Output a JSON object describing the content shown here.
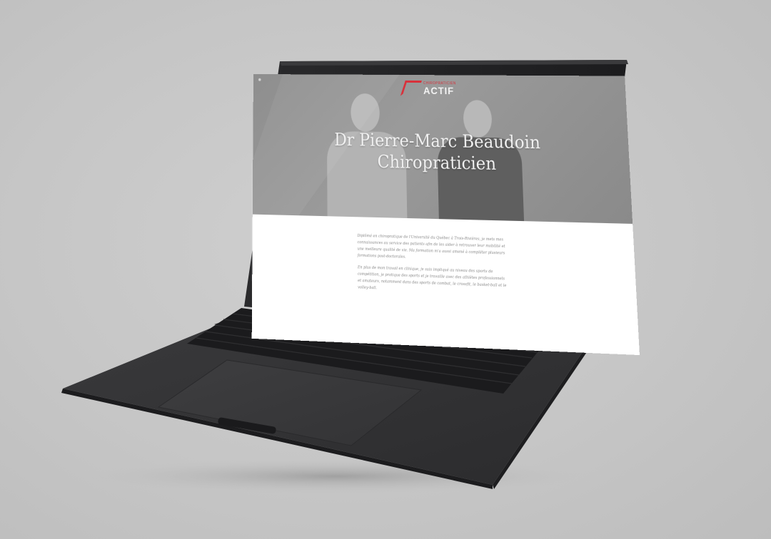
{
  "brand": {
    "small": "CHIROPRATICIEN",
    "name": "ACTIF",
    "accent_color": "#d9303a"
  },
  "hero": {
    "title_line1": "Dr Pierre-Marc Beaudoin",
    "title_line2": "Chiropraticien"
  },
  "content": {
    "paragraph1": "Diplômé en chiropratique de l'Université du Québec à Trois-Rivières, je mets mes connaissances au service des patients afin de les aider à retrouver leur mobilité et une meilleure qualité de vie. Ma formation m'a aussi amené à compléter plusieurs formations post-doctorales.",
    "paragraph2": "En plus de mon travail en clinique, je suis impliqué au niveau des sports de compétition, je pratique des sports et je travaille avec des athlètes professionnels et amateurs, notamment dans des sports de combat, le crossfit, le basket-ball et le volley-ball."
  },
  "icons": {
    "logo": "chiropraticien-actif-logo-icon",
    "menu": "menu-dot-icon"
  }
}
